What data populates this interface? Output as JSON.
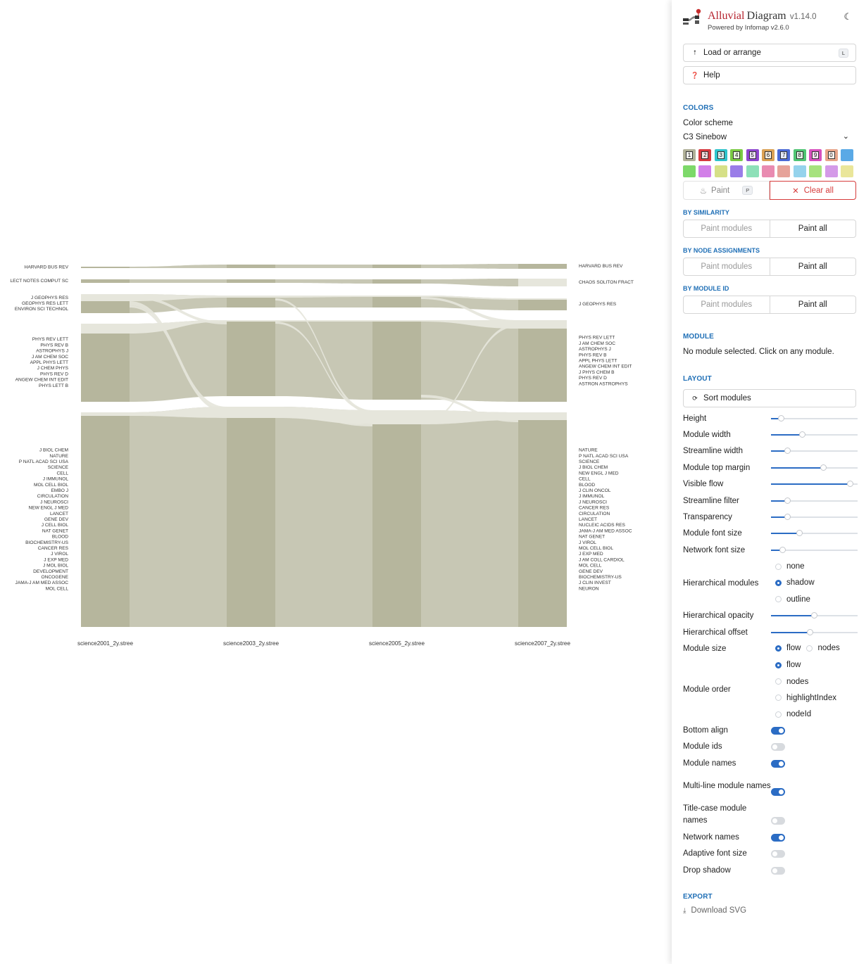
{
  "app": {
    "title_part1": "Alluvial",
    "title_part2": "Diagram",
    "version": "v1.14.0",
    "powered_by": "Powered by Infomap v2.6.0",
    "theme_icon": "moon-icon"
  },
  "actions": {
    "load_label": "Load or arrange",
    "load_key": "L",
    "help_label": "Help"
  },
  "colors": {
    "section": "COLORS",
    "scheme_label": "Color scheme",
    "scheme_value": "C3 Sinebow",
    "swatches": [
      {
        "key": "1",
        "color": "#b0b098"
      },
      {
        "key": "2",
        "color": "#d6383f"
      },
      {
        "key": "3",
        "color": "#2fc3cb"
      },
      {
        "key": "4",
        "color": "#7acb44"
      },
      {
        "key": "5",
        "color": "#8e46cf"
      },
      {
        "key": "6",
        "color": "#dba154"
      },
      {
        "key": "7",
        "color": "#4b6ad6"
      },
      {
        "key": "8",
        "color": "#4fc473"
      },
      {
        "key": "9",
        "color": "#d74fbe"
      },
      {
        "key": "0",
        "color": "#e8a58a"
      },
      {
        "key": "",
        "color": "#5aa9e6"
      },
      {
        "key": "",
        "color": "#7dd96a"
      },
      {
        "key": "",
        "color": "#d27fe8"
      },
      {
        "key": "",
        "color": "#d6e087"
      },
      {
        "key": "",
        "color": "#9a7de8"
      },
      {
        "key": "",
        "color": "#8de0b8"
      },
      {
        "key": "",
        "color": "#e98bb1"
      },
      {
        "key": "",
        "color": "#e6a39a"
      },
      {
        "key": "",
        "color": "#95d3ec"
      },
      {
        "key": "",
        "color": "#a6e27d"
      },
      {
        "key": "",
        "color": "#d49ae8"
      },
      {
        "key": "",
        "color": "#eae69a"
      }
    ],
    "paint_label": "Paint",
    "paint_key": "P",
    "clear_label": "Clear all",
    "clear_color": "#d63c3c"
  },
  "by_similarity": {
    "title": "BY SIMILARITY",
    "left": "Paint modules",
    "right": "Paint all"
  },
  "by_node": {
    "title": "BY NODE ASSIGNMENTS",
    "left": "Paint modules",
    "right": "Paint all"
  },
  "by_module_id": {
    "title": "BY MODULE ID",
    "left": "Paint modules",
    "right": "Paint all"
  },
  "module": {
    "section": "MODULE",
    "text": "No module selected. Click on any module."
  },
  "layout": {
    "section": "LAYOUT",
    "sort_label": "Sort modules",
    "sliders": [
      {
        "label": "Height",
        "value": 0.12
      },
      {
        "label": "Module width",
        "value": 0.36
      },
      {
        "label": "Streamline width",
        "value": 0.19
      },
      {
        "label": "Module top margin",
        "value": 0.6
      },
      {
        "label": "Visible flow",
        "value": 0.91
      },
      {
        "label": "Streamline filter",
        "value": 0.19
      },
      {
        "label": "Transparency",
        "value": 0.19
      },
      {
        "label": "Module font size",
        "value": 0.33
      },
      {
        "label": "Network font size",
        "value": 0.13
      }
    ],
    "hier_label": "Hierarchical modules",
    "hier_opts": [
      "none",
      "shadow",
      "outline"
    ],
    "hier_sel": 1,
    "hier_opacity_label": "Hierarchical opacity",
    "hier_opacity": 0.5,
    "hier_offset_label": "Hierarchical offset",
    "hier_offset": 0.45,
    "module_size_label": "Module size",
    "module_size_opts": [
      "flow",
      "nodes"
    ],
    "module_size_sel": 0,
    "module_order_label": "Module order",
    "module_order_opts": [
      "flow",
      "nodes",
      "highlightIndex",
      "nodeId"
    ],
    "module_order_sel": 0,
    "toggles": [
      {
        "label": "Bottom align",
        "on": true
      },
      {
        "label": "Module ids",
        "on": false
      },
      {
        "label": "Module names",
        "on": true
      },
      {
        "label": "Multi-line module names",
        "on": true
      },
      {
        "label": "Title-case module names",
        "on": false
      },
      {
        "label": "Network names",
        "on": true
      },
      {
        "label": "Adaptive font size",
        "on": false
      },
      {
        "label": "Drop shadow",
        "on": false
      }
    ]
  },
  "export": {
    "section": "EXPORT",
    "download_label": "Download SVG"
  },
  "diagram": {
    "networks": [
      "science2001_2y.stree",
      "science2003_2y.stree",
      "science2005_2y.stree",
      "science2007_2y.stree"
    ],
    "module_color": "#b6b69d",
    "flow_color": "#c7c7b4",
    "highlight_color": "#e6e6dc",
    "modules": [
      {
        "name": "harvard",
        "bounds": [
          [
            379,
            381
          ],
          [
            376,
            381
          ],
          [
            376,
            381
          ],
          [
            375,
            382
          ]
        ]
      },
      {
        "name": "lect",
        "bounds": [
          [
            397,
            402
          ],
          [
            397,
            402
          ],
          [
            397,
            403
          ],
          [
            396,
            407
          ]
        ]
      },
      {
        "name": "geophys",
        "bounds": [
          [
            418,
            445
          ],
          [
            420,
            437
          ],
          [
            420,
            437
          ],
          [
            424,
            441
          ]
        ]
      },
      {
        "name": "phys",
        "bounds": [
          [
            460,
            571
          ],
          [
            455,
            563
          ],
          [
            455,
            568
          ],
          [
            455,
            571
          ]
        ]
      },
      {
        "name": "biol",
        "bounds": [
          [
            586,
            891
          ],
          [
            578,
            891
          ],
          [
            583,
            891
          ],
          [
            586,
            891
          ]
        ]
      }
    ],
    "labels_left": [
      {
        "lines": [
          "HARVARD BUS REV"
        ]
      },
      {
        "lines": [
          "LECT NOTES COMPUT SC"
        ]
      },
      {
        "lines": [
          "J GEOPHYS RES",
          "GEOPHYS RES LETT",
          "ENVIRON SCI TECHNOL"
        ]
      },
      {
        "lines": [
          "PHYS REV LETT",
          "PHYS REV B",
          "ASTROPHYS J",
          "J AM CHEM SOC",
          "APPL PHYS LETT",
          "J CHEM PHYS",
          "PHYS REV D",
          "ANGEW CHEM INT EDIT",
          "PHYS LETT B"
        ]
      },
      {
        "lines": [
          "J BIOL CHEM",
          "NATURE",
          "P NATL ACAD SCI USA",
          "SCIENCE",
          "CELL",
          "J IMMUNOL",
          "MOL CELL BIOL",
          "EMBO J",
          "CIRCULATION",
          "J NEUROSCI",
          "NEW ENGL J MED",
          "LANCET",
          "GENE DEV",
          "J CELL BIOL",
          "NAT GENET",
          "BLOOD",
          "BIOCHEMISTRY-US",
          "CANCER RES",
          "J VIROL",
          "J EXP MED",
          "J MOL BIOL",
          "DEVELOPMENT",
          "ONCOGENE",
          "JAMA-J AM MED ASSOC",
          "MOL CELL"
        ]
      }
    ],
    "labels_right": [
      {
        "lines": [
          "HARVARD BUS REV"
        ]
      },
      {
        "lines": [
          "CHAOS SOLITON FRACT"
        ]
      },
      {
        "lines": [
          "J GEOPHYS RES"
        ]
      },
      {
        "lines": [
          "PHYS REV LETT",
          "J AM CHEM SOC",
          "ASTROPHYS J",
          "PHYS REV B",
          "APPL PHYS LETT",
          "ANGEW CHEM INT EDIT",
          "J PHYS CHEM B",
          "PHYS REV D",
          "ASTRON ASTROPHYS"
        ]
      },
      {
        "lines": [
          "NATURE",
          "P NATL ACAD SCI USA",
          "SCIENCE",
          "J BIOL CHEM",
          "NEW ENGL J MED",
          "CELL",
          "BLOOD",
          "J CLIN ONCOL",
          "J IMMUNOL",
          "J NEUROSCI",
          "CANCER RES",
          "CIRCULATION",
          "LANCET",
          "NUCLEIC ACIDS RES",
          "JAMA-J AM MED ASSOC",
          "NAT GENET",
          "J VIROL",
          "MOL CELL BIOL",
          "J EXP MED",
          "J AM COLL CARDIOL",
          "MOL CELL",
          "GENE DEV",
          "BIOCHEMISTRY-US",
          "J CLIN INVEST",
          "NEURON"
        ]
      }
    ]
  }
}
